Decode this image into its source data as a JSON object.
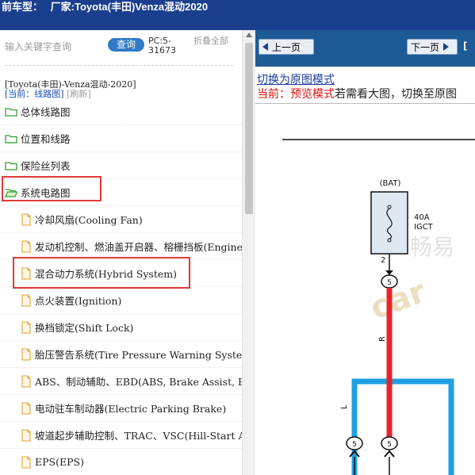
{
  "topbar": {
    "prefix": "前车型：",
    "maker_label": "厂家:",
    "title": "Toyota(丰田)Venza混动2020"
  },
  "search": {
    "placeholder": "输入关键字查询",
    "query_label": "查询",
    "pc_code": "PC:5-31673",
    "collapse_label": "折叠全部"
  },
  "context": {
    "model": "[Toyota(丰田)-Venza混动-2020]",
    "current_prefix": "[当前：线路图]",
    "refresh": "[刷新]"
  },
  "tree": {
    "folders": [
      "总体线路图",
      "位置和线路",
      "保险丝列表",
      "系统电路图"
    ],
    "files": [
      "冷却风扇(Cooling Fan)",
      "发动机控制、燃油盖开启器、榕栅挡板(Engine",
      "混合动力系统(Hybrid System)",
      "点火装置(Ignition)",
      "换档锁定(Shift Lock)",
      "胎压警告系统(Tire Pressure Warning System)",
      "ABS、制动辅助、EBD(ABS, Brake Assist, EBD",
      "电动驻车制动器(Electric Parking Brake)",
      "坡道起步辅助控制、TRAC、VSC(Hill-Start As",
      "EPS(EPS)"
    ]
  },
  "viewer": {
    "prev_label": "上一页",
    "next_label": "下一页",
    "nav_extra": "[",
    "mode_link": "切换为原图模式",
    "mode_current": "当前：预览模式",
    "mode_hint": "若需看大图，切换至原图"
  },
  "diagram": {
    "component": "(BAT)",
    "fuse_rating": "40A",
    "fuse_name": "IGCT",
    "pin_top": "2",
    "connector_top": "5",
    "wire_red": "R",
    "wire_blue": "L",
    "connector_left": "5",
    "connector_right": "5",
    "watermark": "畅易",
    "colors": {
      "red_wire": "#e8232b",
      "blue_wire": "#1ea0e0"
    }
  },
  "colors": {
    "topbar": "#1b3f8f",
    "navbar": "#1e5a96",
    "query_button": "#2f7bc8",
    "highlight": "#e03a3a",
    "folder": "#2fa12f",
    "file": "#e0a030"
  }
}
